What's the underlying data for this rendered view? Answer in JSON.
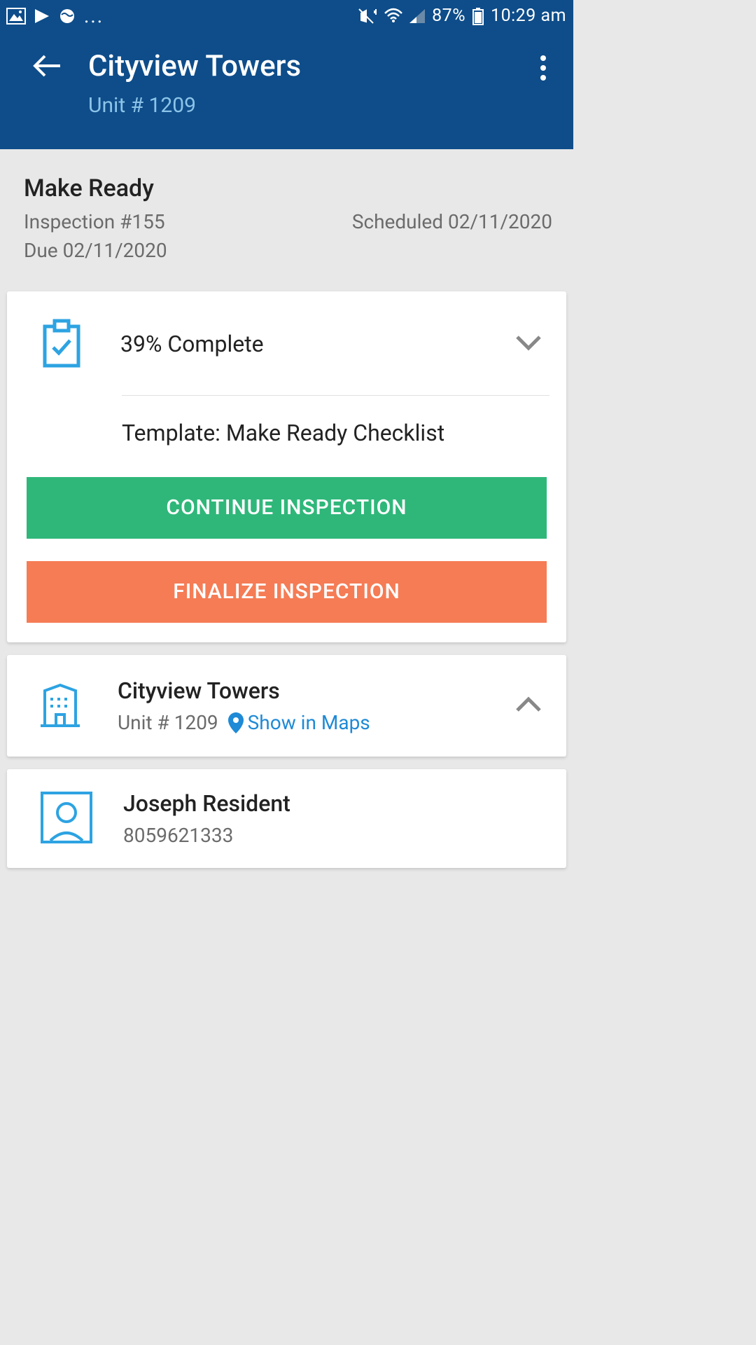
{
  "status": {
    "battery": "87%",
    "time": "10:29 am"
  },
  "header": {
    "title": "Cityview Towers",
    "subtitle": "Unit # 1209"
  },
  "section": {
    "title": "Make Ready",
    "inspection_line": "Inspection #155",
    "due_line": "Due 02/11/2020",
    "scheduled_line": "Scheduled 02/11/2020"
  },
  "progress": {
    "percent_label": "39% Complete",
    "template_label": "Template: Make Ready Checklist"
  },
  "buttons": {
    "continue": "CONTINUE INSPECTION",
    "finalize": "FINALIZE INSPECTION"
  },
  "property": {
    "name": "Cityview Towers",
    "unit": "Unit # 1209",
    "map_link": "Show in Maps"
  },
  "resident": {
    "name": "Joseph Resident",
    "phone": "8059621333"
  }
}
